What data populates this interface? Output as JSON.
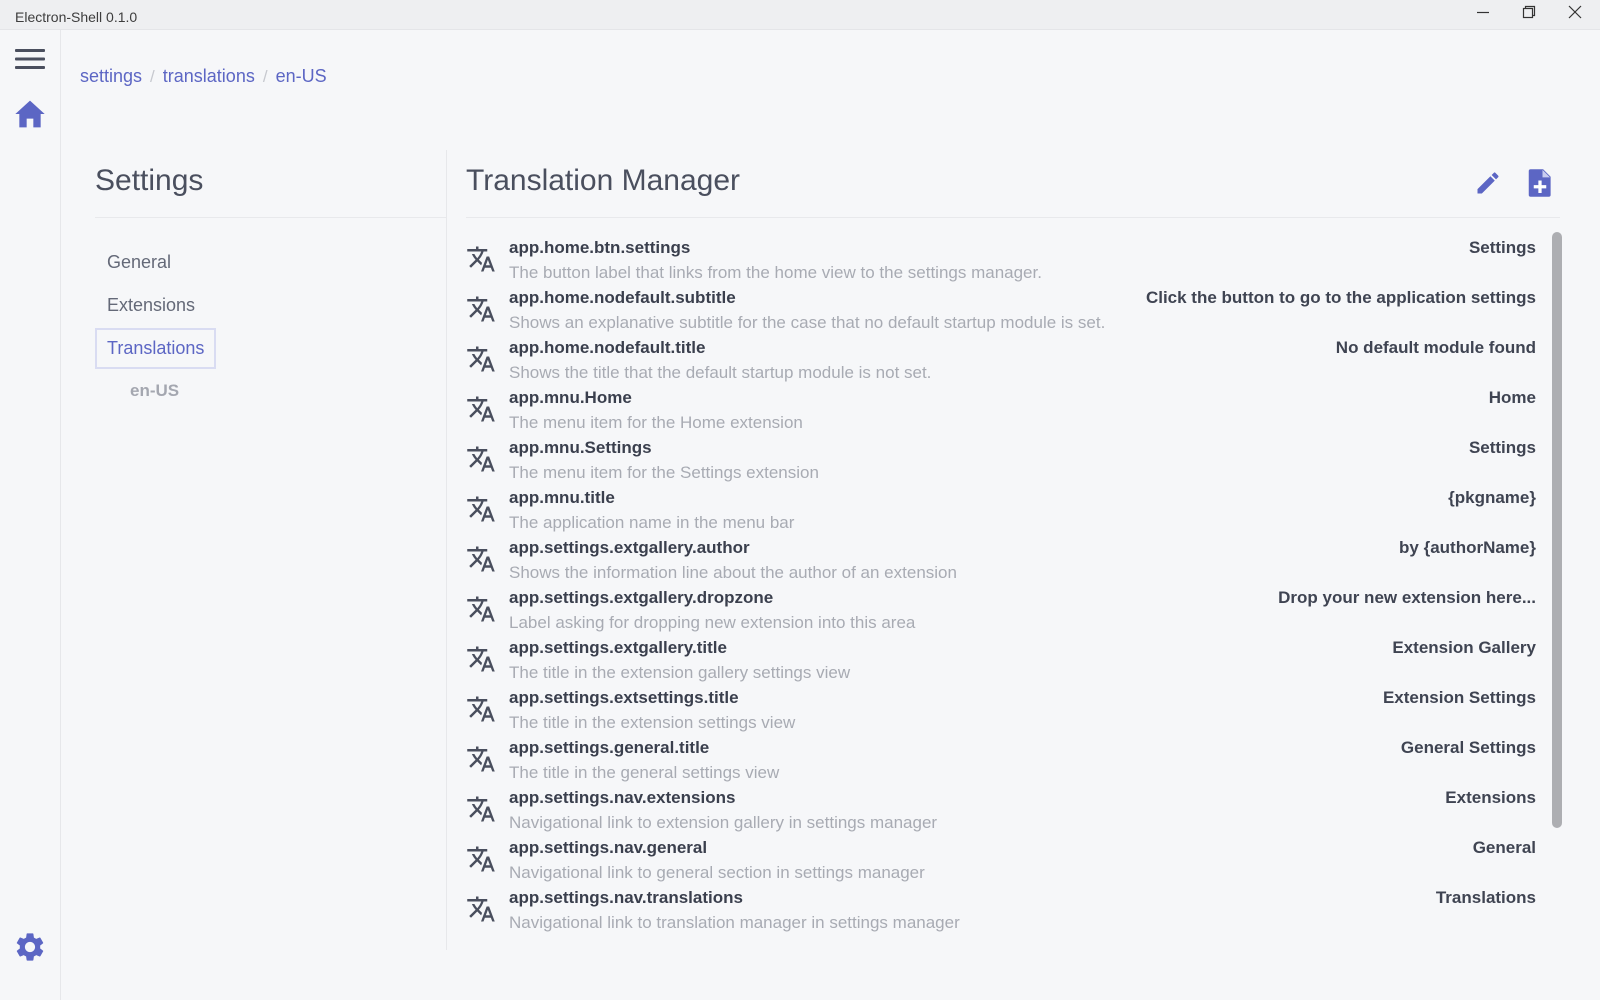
{
  "window": {
    "title": "Electron-Shell 0.1.0"
  },
  "breadcrumb": [
    {
      "label": "settings"
    },
    {
      "label": "translations"
    },
    {
      "label": "en-US"
    }
  ],
  "breadcrumb_separator": "/",
  "settings": {
    "title": "Settings",
    "nav": [
      {
        "label": "General"
      },
      {
        "label": "Extensions"
      },
      {
        "label": "Translations"
      }
    ],
    "sub_item": "en-US"
  },
  "main": {
    "title": "Translation Manager",
    "rows": [
      {
        "key": "app.home.btn.settings",
        "description": "The button label that links from the home view to the settings manager.",
        "value": "Settings"
      },
      {
        "key": "app.home.nodefault.subtitle",
        "description": "Shows an explanative subtitle for the case that no default startup module is set.",
        "value": "Click the button to go to the application settings"
      },
      {
        "key": "app.home.nodefault.title",
        "description": "Shows the title that the default startup module is not set.",
        "value": "No default module found"
      },
      {
        "key": "app.mnu.Home",
        "description": "The menu item for the Home extension",
        "value": "Home"
      },
      {
        "key": "app.mnu.Settings",
        "description": "The menu item for the Settings extension",
        "value": "Settings"
      },
      {
        "key": "app.mnu.title",
        "description": "The application name in the menu bar",
        "value": "{pkgname}"
      },
      {
        "key": "app.settings.extgallery.author",
        "description": "Shows the information line about the author of an extension",
        "value": "by {authorName}"
      },
      {
        "key": "app.settings.extgallery.dropzone",
        "description": "Label asking for dropping new extension into this area",
        "value": "Drop your new extension here..."
      },
      {
        "key": "app.settings.extgallery.title",
        "description": "The title in the extension gallery settings view",
        "value": "Extension Gallery"
      },
      {
        "key": "app.settings.extsettings.title",
        "description": "The title in the extension settings view",
        "value": "Extension Settings"
      },
      {
        "key": "app.settings.general.title",
        "description": "The title in the general settings view",
        "value": "General Settings"
      },
      {
        "key": "app.settings.nav.extensions",
        "description": "Navigational link to extension gallery in settings manager",
        "value": "Extensions"
      },
      {
        "key": "app.settings.nav.general",
        "description": "Navigational link to general section in settings manager",
        "value": "General"
      },
      {
        "key": "app.settings.nav.translations",
        "description": "Navigational link to translation manager in settings manager",
        "value": "Translations"
      }
    ]
  },
  "icons": {
    "menu": "hamburger-icon",
    "home": "home-icon",
    "settings": "gear-icon",
    "edit": "pencil-icon",
    "add": "file-plus-icon",
    "row": "translate-icon"
  },
  "colors": {
    "accent": "#5c66c4",
    "key_text": "#3a3f4d",
    "description_text": "#a8abb3",
    "background": "#f6f7f9"
  }
}
